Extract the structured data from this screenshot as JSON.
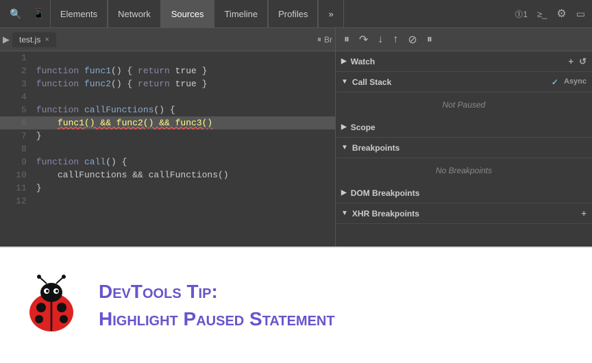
{
  "toolbar": {
    "tabs": [
      {
        "label": "Elements",
        "active": false
      },
      {
        "label": "Network",
        "active": false
      },
      {
        "label": "Sources",
        "active": true
      },
      {
        "label": "Timeline",
        "active": false
      },
      {
        "label": "Profiles",
        "active": false
      }
    ],
    "right": {
      "badge": "⓵1",
      "console_icon": "≥_",
      "gear_icon": "⚙",
      "screen_icon": "▭"
    }
  },
  "editor": {
    "filename": "test.js",
    "lines": [
      {
        "num": 1,
        "code": ""
      },
      {
        "num": 2,
        "code": "function func1() { return true }"
      },
      {
        "num": 3,
        "code": "function func2() { return true }"
      },
      {
        "num": 4,
        "code": ""
      },
      {
        "num": 5,
        "code": "function callFunctions() {"
      },
      {
        "num": 6,
        "code": "    func1() && func2() && func3()",
        "highlight": true,
        "squiggle": true
      },
      {
        "num": 7,
        "code": "}"
      },
      {
        "num": 8,
        "code": ""
      },
      {
        "num": 9,
        "code": "function call() {"
      },
      {
        "num": 10,
        "code": "    callFunctions && callFunctions()"
      },
      {
        "num": 11,
        "code": "}"
      },
      {
        "num": 12,
        "code": ""
      }
    ]
  },
  "debug": {
    "sections": [
      {
        "name": "Watch",
        "expanded": false,
        "actions": [
          "+",
          "↺"
        ]
      },
      {
        "name": "Call Stack",
        "expanded": true,
        "body": "Not Paused",
        "async_label": "Async",
        "async_checked": true
      },
      {
        "name": "Scope",
        "expanded": false
      },
      {
        "name": "Breakpoints",
        "expanded": true,
        "body": "No Breakpoints"
      },
      {
        "name": "DOM Breakpoints",
        "expanded": false
      },
      {
        "name": "XHR Breakpoints",
        "expanded": false,
        "actions": [
          "+"
        ]
      }
    ]
  },
  "tip": {
    "prefix": "DevTools Tip:",
    "title": "Highlight Paused Statement"
  }
}
